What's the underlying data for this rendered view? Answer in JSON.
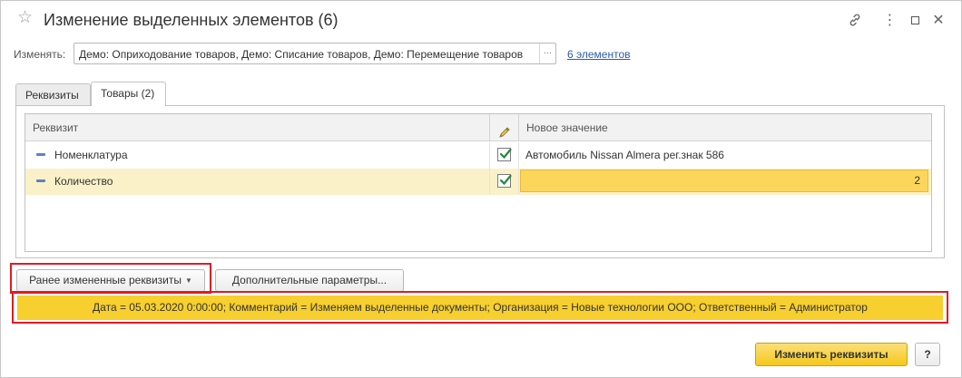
{
  "window": {
    "title": "Изменение выделенных элементов (6)",
    "more_glyph": "⋮",
    "close_glyph": "✕"
  },
  "change": {
    "label": "Изменять:",
    "value": "Демо: Оприходование товаров, Демо: Списание товаров, Демо: Перемещение товаров",
    "choose_glyph": "...",
    "elements_link": "6 элементов"
  },
  "tabs": [
    {
      "label": "Реквизиты",
      "active": false
    },
    {
      "label": "Товары (2)",
      "active": true
    }
  ],
  "grid": {
    "columns": [
      "Реквизит",
      "",
      "Новое значение"
    ],
    "rows": [
      {
        "attribute": "Номенклатура",
        "checked": true,
        "new_value": "Автомобиль Nissan Almera рег.знак 586"
      },
      {
        "attribute": "Количество",
        "checked": true,
        "new_value": "2"
      }
    ]
  },
  "buttons": {
    "previous": "Ранее измененные реквизиты",
    "previous_arrow": "▼",
    "extra": "Дополнительные параметры...",
    "apply": "Изменить реквизиты",
    "help": "?"
  },
  "summary": "Дата = 05.03.2020 0:00:00; Комментарий = Изменяем выделенные документы; Организация = Новые технологии ООО; Ответственный = Администратор",
  "colors": {
    "accent_yellow": "#f7cf2e",
    "highlight_row": "#fbf1c8",
    "annotation_red": "#e01b24",
    "link_blue": "#2a5ea8"
  },
  "icons": [
    "star-icon",
    "link-icon",
    "more-icon",
    "maximize-icon",
    "close-icon",
    "pencil-icon",
    "checkbox-icon"
  ]
}
